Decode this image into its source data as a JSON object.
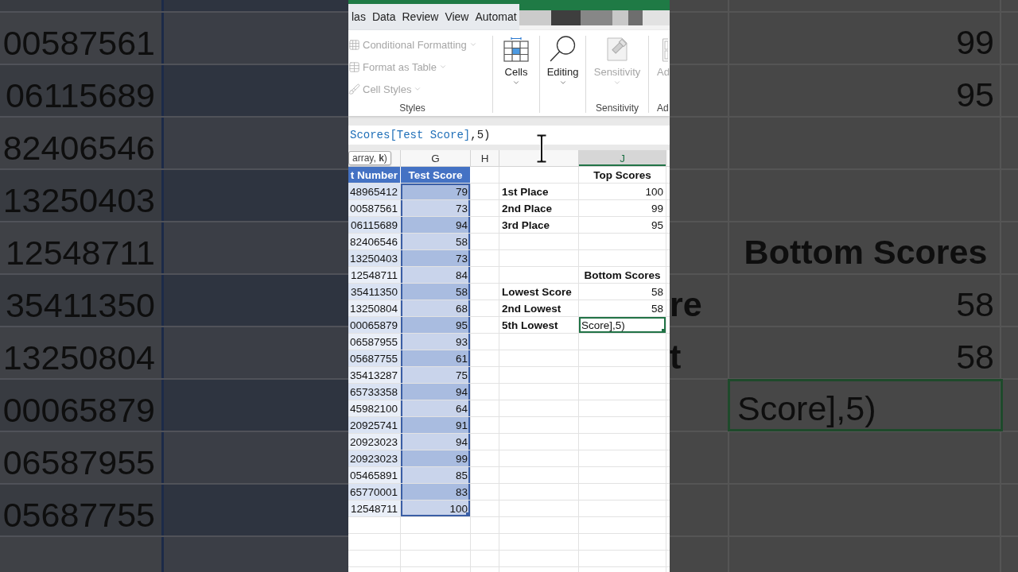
{
  "left_backdrop": {
    "numbers": [
      "00587561",
      "06115689",
      "82406546",
      "13250403",
      "12548711",
      "35411350",
      "13250804",
      "00065879",
      "06587955",
      "05687755"
    ]
  },
  "ribbon": {
    "tabs": [
      {
        "label": "las",
        "selected": false
      },
      {
        "label": "Data",
        "selected": false
      },
      {
        "label": "Review",
        "selected": false
      },
      {
        "label": "View",
        "selected": false
      },
      {
        "label": "Automat",
        "selected": false
      }
    ],
    "groups": [
      {
        "kind": "list",
        "label": "Styles",
        "items": [
          {
            "label": "Conditional Formatting",
            "disabled": true
          },
          {
            "label": "Format as Table",
            "disabled": true
          },
          {
            "label": "Cell Styles",
            "disabled": true
          }
        ]
      },
      {
        "kind": "large",
        "items": [
          {
            "label": "Cells",
            "disabled": false
          }
        ]
      },
      {
        "kind": "large",
        "items": [
          {
            "label": "Editing",
            "disabled": false
          }
        ]
      },
      {
        "kind": "large",
        "label": "Sensitivity",
        "items": [
          {
            "label": "Sensitivity",
            "disabled": true
          }
        ]
      },
      {
        "kind": "partial",
        "label": "Ad",
        "items": [
          {
            "label": "Ad",
            "disabled": true
          }
        ]
      }
    ]
  },
  "formula_bar": {
    "reference": "Scores[Test Score]",
    "rest": ",5)"
  },
  "sheet": {
    "tooltip": "array, **k**)",
    "column_headers": [
      {
        "label": "G",
        "selected": false
      },
      {
        "label": "H",
        "selected": false
      },
      {
        "label": "J",
        "selected": true
      }
    ]
  },
  "table": {
    "columns": [
      {
        "label": "t Number",
        "selected": false
      },
      {
        "label": "Test Score",
        "selected": true
      }
    ],
    "rows": [
      [
        "48965412",
        "79"
      ],
      [
        "00587561",
        "73"
      ],
      [
        "06115689",
        "94"
      ],
      [
        "82406546",
        "58"
      ],
      [
        "13250403",
        "73"
      ],
      [
        "12548711",
        "84"
      ],
      [
        "35411350",
        "58"
      ],
      [
        "13250804",
        "68"
      ],
      [
        "00065879",
        "95"
      ],
      [
        "06587955",
        "93"
      ],
      [
        "05687755",
        "61"
      ],
      [
        "35413287",
        "75"
      ],
      [
        "65733358",
        "94"
      ],
      [
        "45982100",
        "64"
      ],
      [
        "20925741",
        "91"
      ],
      [
        "20923023",
        "94"
      ],
      [
        "20923023",
        "99"
      ],
      [
        "05465891",
        "85"
      ],
      [
        "65770001",
        "83"
      ],
      [
        "12548711",
        "100"
      ]
    ]
  },
  "top_scores": {
    "title": "Top Scores",
    "rows": [
      {
        "label": "1st Place",
        "value": "100"
      },
      {
        "label": "2nd Place",
        "value": "99"
      },
      {
        "label": "3rd Place",
        "value": "95"
      }
    ]
  },
  "bottom_scores": {
    "title": "Bottom Scores",
    "rows": [
      {
        "label": "Lowest Score",
        "value": "58",
        "editing": false
      },
      {
        "label": "2nd Lowest",
        "value": "58",
        "editing": false
      },
      {
        "label": "5th Lowest",
        "value": "Score],5)",
        "editing": true
      }
    ]
  },
  "right_backdrop": {
    "values": [
      "99",
      "95"
    ],
    "title": "Bottom Scores",
    "rows": [
      {
        "label": "re",
        "value": "58"
      },
      {
        "label": "t",
        "value": "58"
      }
    ],
    "editing_value": "Score],5)"
  }
}
